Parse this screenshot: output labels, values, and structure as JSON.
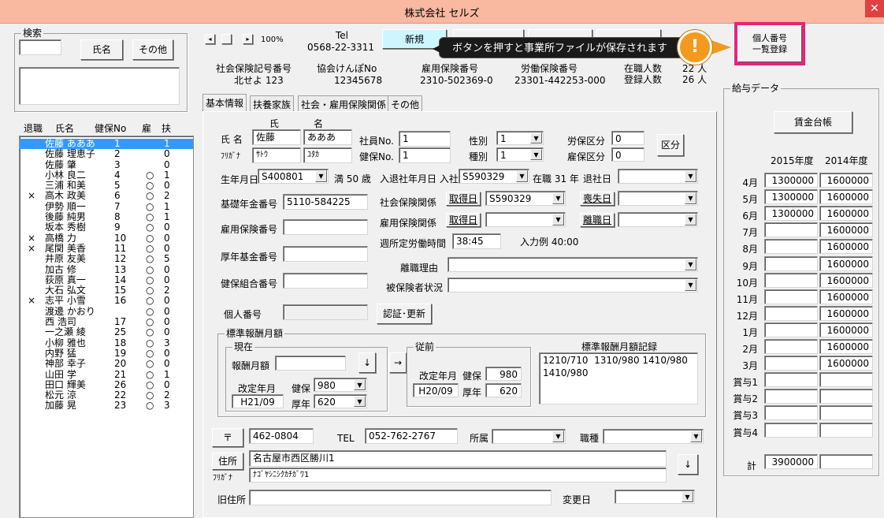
{
  "window": {
    "title": "株式会社 セルズ",
    "close": "✕"
  },
  "search": {
    "label": "検索",
    "name_btn": "氏名",
    "other_btn": "その他",
    "input_value": "",
    "memo_value": ""
  },
  "employee_list": {
    "headers": {
      "retired": "退職",
      "name": "氏名",
      "kenpo_no": "健保No",
      "koyo": "雇",
      "fuyo": "扶"
    },
    "rows": [
      {
        "retired": "",
        "name": "佐藤 あああ",
        "no": "1",
        "koyo": "",
        "fuyo": "1"
      },
      {
        "retired": "",
        "name": "佐藤 理恵子",
        "no": "2",
        "koyo": "",
        "fuyo": "0"
      },
      {
        "retired": "",
        "name": "佐藤 肇",
        "no": "3",
        "koyo": "",
        "fuyo": "0"
      },
      {
        "retired": "",
        "name": "小林 良二",
        "no": "4",
        "koyo": "○",
        "fuyo": "1"
      },
      {
        "retired": "",
        "name": "三浦 和美",
        "no": "5",
        "koyo": "○",
        "fuyo": "0"
      },
      {
        "retired": "×",
        "name": "高木 政美",
        "no": "6",
        "koyo": "○",
        "fuyo": "2"
      },
      {
        "retired": "",
        "name": "伊勢 順一",
        "no": "7",
        "koyo": "○",
        "fuyo": "1"
      },
      {
        "retired": "",
        "name": "後藤 純男",
        "no": "8",
        "koyo": "○",
        "fuyo": "1"
      },
      {
        "retired": "",
        "name": "坂本 秀樹",
        "no": "9",
        "koyo": "○",
        "fuyo": "0"
      },
      {
        "retired": "×",
        "name": "高橋 力",
        "no": "10",
        "koyo": "○",
        "fuyo": "0"
      },
      {
        "retired": "×",
        "name": "尾関 美香",
        "no": "11",
        "koyo": "○",
        "fuyo": "0"
      },
      {
        "retired": "",
        "name": "井原 友美",
        "no": "12",
        "koyo": "○",
        "fuyo": "5"
      },
      {
        "retired": "",
        "name": "加古 修",
        "no": "13",
        "koyo": "○",
        "fuyo": "0"
      },
      {
        "retired": "",
        "name": "荻原 真一",
        "no": "14",
        "koyo": "○",
        "fuyo": "0"
      },
      {
        "retired": "",
        "name": "大石 弘文",
        "no": "15",
        "koyo": "○",
        "fuyo": "2"
      },
      {
        "retired": "×",
        "name": "志平 小雪",
        "no": "16",
        "koyo": "○",
        "fuyo": "0"
      },
      {
        "retired": "",
        "name": "渡邊 かおり",
        "no": "",
        "koyo": "○",
        "fuyo": "0"
      },
      {
        "retired": "",
        "name": "西 浩司",
        "no": "17",
        "koyo": "○",
        "fuyo": "0"
      },
      {
        "retired": "",
        "name": "一之瀬 綾",
        "no": "25",
        "koyo": "○",
        "fuyo": "0"
      },
      {
        "retired": "",
        "name": "小柳 雅也",
        "no": "18",
        "koyo": "○",
        "fuyo": "3"
      },
      {
        "retired": "",
        "name": "内野 猛",
        "no": "19",
        "koyo": "○",
        "fuyo": "0"
      },
      {
        "retired": "",
        "name": "神部 幸子",
        "no": "20",
        "koyo": "○",
        "fuyo": "0"
      },
      {
        "retired": "",
        "name": "山田 学",
        "no": "21",
        "koyo": "○",
        "fuyo": "1"
      },
      {
        "retired": "",
        "name": "田口 輝美",
        "no": "26",
        "koyo": "○",
        "fuyo": "0"
      },
      {
        "retired": "",
        "name": "松元 涼",
        "no": "22",
        "koyo": "○",
        "fuyo": "2"
      },
      {
        "retired": "",
        "name": "加藤 晃",
        "no": "23",
        "koyo": "○",
        "fuyo": "3"
      }
    ]
  },
  "nav": {
    "first": "◂",
    "prev": "",
    "next": "▸",
    "zoom": "100%"
  },
  "company": {
    "tel_label": "Tel",
    "tel": "0568-22-3311",
    "new_btn": "新規",
    "shaho_label": "社会保険記号番号",
    "shaho": "北せよ 123",
    "kyokai_label": "協会けんぽNo",
    "kyokai": "12345678",
    "koyo_label": "雇用保険番号",
    "koyo": "2310-502369-0",
    "rodo_label": "労働保険番号",
    "rodo": "23301-442253-000",
    "zaishoku_label": "在職人数",
    "zaishoku": "22 人",
    "toroku_label": "登録人数",
    "toroku": "26 人"
  },
  "callout": {
    "text": "ボタンを押すと事業所ファイルが保存されます",
    "warn_icon": "!"
  },
  "kojin_btn": "個人番号\n一覧登録",
  "tabs": [
    "基本情報",
    "扶養家族",
    "社会・雇用保険関係",
    "その他"
  ],
  "basic": {
    "shi": "氏",
    "mei": "名",
    "name_label": "氏 名",
    "furigana_label": "ﾌﾘｶﾞﾅ",
    "sei": "佐藤",
    "mei_val": "あああ",
    "sei_kana": "ｻﾄｳ",
    "mei_kana": "ﾕﾀｶ",
    "shain_label": "社員No.",
    "shain": "1",
    "kenpo_label": "健保No.",
    "kenpo": "1",
    "seibetsu_label": "性別",
    "seibetsu": "1",
    "shubetsu_label": "種別",
    "shubetsu": "1",
    "rouho_label": "労保区分",
    "rouho": "0",
    "koyoho_label": "雇保区分",
    "koyoho": "0",
    "kubun_btn": "区分",
    "birth_label": "生年月日",
    "birth": "S400801",
    "age": "満 50 歳",
    "nyusha_label": "入退社年月日 入社",
    "nyusha": "S590329",
    "zaishoku": "在職 31 年",
    "taisha_label": "退社日",
    "taisha": "",
    "kiso_label": "基礎年金番号",
    "kiso": "5110-584225",
    "shaho_label": "社会保険関係",
    "shutoku_btn": "取得日",
    "shaho_shutoku": "S590329",
    "soshitsu_btn": "喪失日",
    "shaho_soshitsu": "",
    "koyo_label": "雇用保険番号",
    "koyo": "",
    "koyo_kankei_label": "雇用保険関係",
    "koyo_shutoku_btn": "取得日",
    "koyo_shutoku": "",
    "rishoku_btn": "離職日",
    "rishoku": "",
    "shotei_label": "週所定労働時間",
    "shotei": "38:45",
    "input_example": "入力例  40:00",
    "kosei_label": "厚年基金番号",
    "kosei": "",
    "rishoku_riyu_label": "離職理由",
    "rishoku_riyu": "",
    "kenpo_kumiai_label": "健保組合番号",
    "kenpo_kumiai": "",
    "hihokensha_label": "被保険者状況",
    "hihokensha": "",
    "kojin_label": "個人番号",
    "kojin": "",
    "ninsho_btn": "認証･更新"
  },
  "standard": {
    "title": "標準報酬月額",
    "current_title": "現在",
    "houshu_label": "報酬月額",
    "houshu": "",
    "down_btn": "↓",
    "right_btn": "→",
    "kaitei_label": "改定年月",
    "kaitei": "H21/09",
    "kenpo_label": "健保",
    "kenpo": "980",
    "kounen_label": "厚年",
    "kounen": "620",
    "prev_title": "従前",
    "prev_kaitei": "H20/09",
    "prev_kenpo": "980",
    "prev_kounen": "620",
    "record_title": "標準報酬月額記録",
    "record": "1210/710  1310/980 1410/980\n1410/980"
  },
  "address": {
    "zip_btn": "〒",
    "zip": "462-0804",
    "tel_label": "TEL",
    "tel": "052-762-2767",
    "shozoku_label": "所属",
    "shozoku": "",
    "shokushu_label": "職種",
    "shokushu": "",
    "jusho_btn": "住所",
    "furigana_label": "ﾌﾘｶﾞﾅ",
    "jusho": "名古屋市西区勝川1",
    "jusho_kana": "ﾅｺﾞﾔｼﾆｼｸｶﾁｶﾞﾜ1",
    "down_btn": "↓",
    "old_label": "旧住所",
    "old": "",
    "henko_label": "変更日",
    "henko": ""
  },
  "salary": {
    "title": "給与データ",
    "ledger_btn": "賃金台帳",
    "year1": "2015年度",
    "year2": "2014年度",
    "rows": [
      {
        "label": "4月",
        "y1": "1300000",
        "y2": "1600000"
      },
      {
        "label": "5月",
        "y1": "1300000",
        "y2": "1600000"
      },
      {
        "label": "6月",
        "y1": "1300000",
        "y2": "1600000"
      },
      {
        "label": "7月",
        "y1": "",
        "y2": "1600000"
      },
      {
        "label": "8月",
        "y1": "",
        "y2": "1600000"
      },
      {
        "label": "9月",
        "y1": "",
        "y2": "1600000"
      },
      {
        "label": "10月",
        "y1": "",
        "y2": "1600000"
      },
      {
        "label": "11月",
        "y1": "",
        "y2": "1600000"
      },
      {
        "label": "12月",
        "y1": "",
        "y2": "1600000"
      },
      {
        "label": "1月",
        "y1": "",
        "y2": "1600000"
      },
      {
        "label": "2月",
        "y1": "",
        "y2": "1600000"
      },
      {
        "label": "3月",
        "y1": "",
        "y2": "1600000"
      },
      {
        "label": "賞与1",
        "y1": "",
        "y2": ""
      },
      {
        "label": "賞与2",
        "y1": "",
        "y2": ""
      },
      {
        "label": "賞与3",
        "y1": "",
        "y2": ""
      },
      {
        "label": "賞与4",
        "y1": "",
        "y2": ""
      }
    ],
    "total_label": "計",
    "total1": "3900000",
    "total2": ""
  }
}
